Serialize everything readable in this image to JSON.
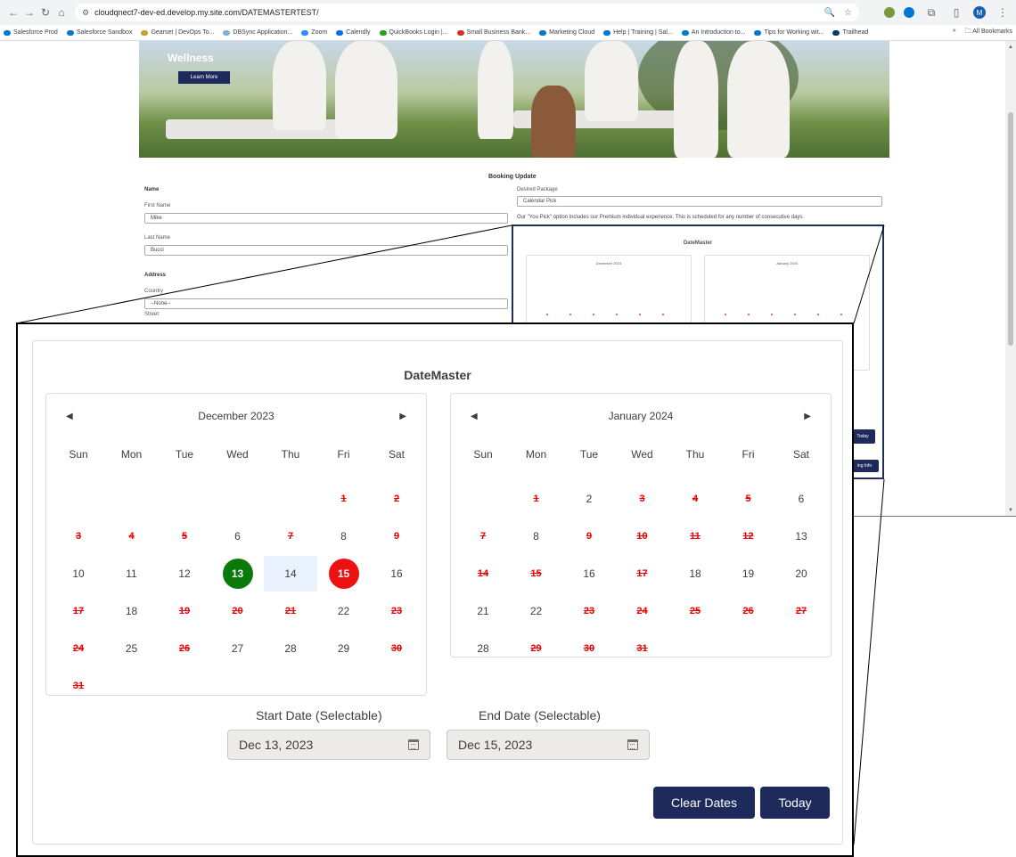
{
  "browser": {
    "url": "cloudqnect7-dev-ed.develop.my.site.com/DATEMASTERTEST/",
    "bookmarks": [
      "Salesforce Prod",
      "Salesforce Sandbox",
      "Gearset | DevOps To...",
      "DBSync Application...",
      "Zoom",
      "Calendly",
      "QuickBooks Login |...",
      "Small Business Bank...",
      "Marketing Cloud",
      "Help | Training | Sal...",
      "An Introduction to...",
      "Tips for Working wit...",
      "Trailhead"
    ],
    "all_bookmarks": "All Bookmarks",
    "more": "»",
    "profile_initial": "M"
  },
  "hero": {
    "title": "Wellness",
    "button": "Learn More"
  },
  "form": {
    "title": "Booking Update",
    "name_label": "Name",
    "first_name_label": "First Name",
    "first_name": "Mike",
    "last_name_label": "Last Name",
    "last_name": "Bucci",
    "address_label": "Address",
    "country_label": "Country",
    "country": "--None--",
    "street_label": "Street",
    "package_label": "Desired Package",
    "package": "Calendar Pick",
    "package_note": "Our \"You Pick\" option includes our Premium individual experience. This is scheduled for any number of consecutive days."
  },
  "small_widget": {
    "title": "DateMaster",
    "month1": "December 2023",
    "month2": "January 2024",
    "today": "Today",
    "billing": "ing Info"
  },
  "datemaster": {
    "title": "DateMaster",
    "weekdays": [
      "Sun",
      "Mon",
      "Tue",
      "Wed",
      "Thu",
      "Fri",
      "Sat"
    ],
    "months": [
      {
        "name": "December 2023",
        "offset": 5,
        "days": 31,
        "disabled": [
          1,
          2,
          3,
          4,
          5,
          7,
          9,
          17,
          19,
          20,
          21,
          23,
          24,
          26,
          30,
          31
        ],
        "start": 13,
        "end": 15
      },
      {
        "name": "January 2024",
        "offset": 1,
        "days": 31,
        "disabled": [
          1,
          3,
          4,
          5,
          7,
          9,
          10,
          11,
          12,
          14,
          15,
          17,
          23,
          24,
          25,
          26,
          27,
          29,
          30,
          31
        ],
        "start": null,
        "end": null
      }
    ],
    "start_label": "Start Date (Selectable)",
    "start_value": "Dec 13, 2023",
    "end_label": "End Date (Selectable)",
    "end_value": "Dec 15, 2023",
    "clear_button": "Clear Dates",
    "today_button": "Today"
  }
}
